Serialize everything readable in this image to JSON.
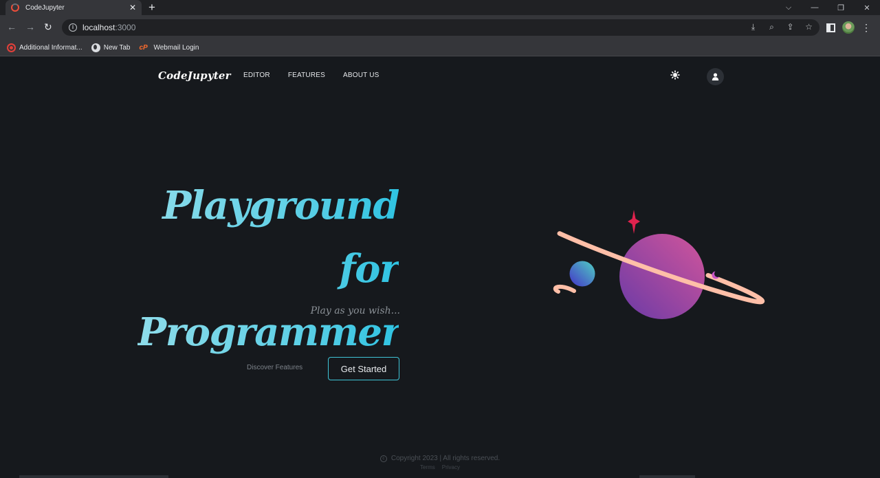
{
  "browser": {
    "tab_title": "CodeJupyter",
    "tab_close": "✕",
    "new_tab": "+",
    "window_buttons": [
      "⌵",
      "—",
      "❐",
      "✕"
    ],
    "url_host": "localhost",
    "url_port": ":3000",
    "bookmarks": [
      {
        "label": "Additional Informat...",
        "icon": "red-circle-icon"
      },
      {
        "label": "New Tab",
        "icon": "globe-icon"
      },
      {
        "label": "Webmail Login",
        "icon": "cpanel-icon"
      }
    ]
  },
  "site": {
    "logo": "CodeJupyter",
    "nav": [
      "EDITOR",
      "FEATURES",
      "ABOUT US"
    ]
  },
  "hero": {
    "title_line1": "Playground for",
    "title_line2": "Programmer",
    "tagline": "Play as you wish...",
    "discover_label": "Discover Features",
    "cta_label": "Get Started"
  },
  "footer": {
    "copyright": "Copyright 2023 | All rights reserved.",
    "links": [
      "Terms",
      "Privacy"
    ]
  },
  "colors": {
    "page_bg": "#16191d",
    "accent_cyan": "#3fc6d8",
    "planet_purple": "#9b4bb0",
    "ring_peach": "#ffbfa8",
    "star_red": "#e0234e"
  }
}
